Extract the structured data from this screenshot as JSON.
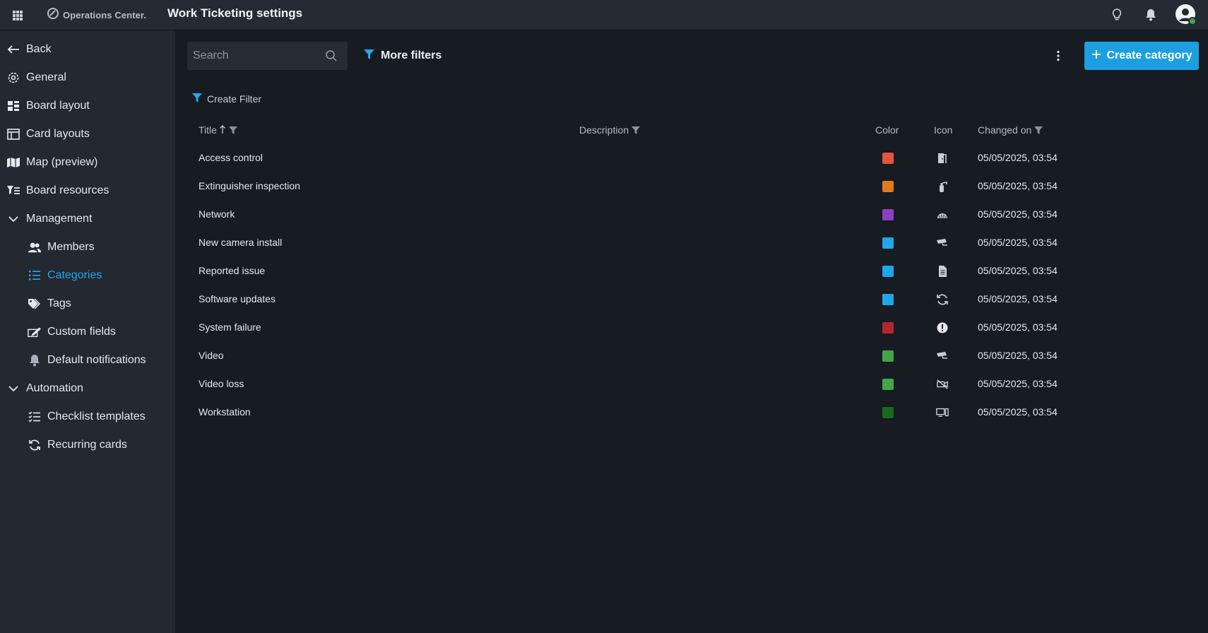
{
  "app": {
    "brand": "Operations Center.",
    "page_title": "Work Ticketing settings"
  },
  "sidebar": {
    "back": "Back",
    "general": "General",
    "board_layout": "Board layout",
    "card_layouts": "Card layouts",
    "map_preview": "Map (preview)",
    "board_resources": "Board resources",
    "management": "Management",
    "members": "Members",
    "categories": "Categories",
    "tags": "Tags",
    "custom_fields": "Custom fields",
    "default_notifications": "Default notifications",
    "automation": "Automation",
    "checklist_templates": "Checklist templates",
    "recurring_cards": "Recurring cards",
    "active_item": "Categories"
  },
  "toolbar": {
    "search_placeholder": "Search",
    "more_filters": "More filters",
    "create_category": "Create category",
    "create_filter": "Create Filter"
  },
  "table": {
    "headers": {
      "title": "Title",
      "description": "Description",
      "color": "Color",
      "icon": "Icon",
      "changed_on": "Changed on"
    },
    "sort": {
      "column": "Title",
      "direction": "ascending"
    },
    "rows": [
      {
        "title": "Access control",
        "description": "",
        "color": "#e5533c",
        "icon": "door-icon",
        "changed_on": "05/05/2025, 03:54"
      },
      {
        "title": "Extinguisher inspection",
        "description": "",
        "color": "#e07b1c",
        "icon": "fire-extinguisher-icon",
        "changed_on": "05/05/2025, 03:54"
      },
      {
        "title": "Network",
        "description": "",
        "color": "#8b3fc6",
        "icon": "network-icon",
        "changed_on": "05/05/2025, 03:54"
      },
      {
        "title": "New camera install",
        "description": "",
        "color": "#1ea7ea",
        "icon": "camera-icon",
        "changed_on": "05/05/2025, 03:54"
      },
      {
        "title": "Reported issue",
        "description": "",
        "color": "#1ea7ea",
        "icon": "document-icon",
        "changed_on": "05/05/2025, 03:54"
      },
      {
        "title": "Software updates",
        "description": "",
        "color": "#1ea7ea",
        "icon": "refresh-icon",
        "changed_on": "05/05/2025, 03:54"
      },
      {
        "title": "System failure",
        "description": "",
        "color": "#b5262e",
        "icon": "alert-icon",
        "changed_on": "05/05/2025, 03:54"
      },
      {
        "title": "Video",
        "description": "",
        "color": "#43a74a",
        "icon": "camera-icon",
        "changed_on": "05/05/2025, 03:54"
      },
      {
        "title": "Video loss",
        "description": "",
        "color": "#43a74a",
        "icon": "video-off-icon",
        "changed_on": "05/05/2025, 03:54"
      },
      {
        "title": "Workstation",
        "description": "",
        "color": "#176b1e",
        "icon": "workstation-icon",
        "changed_on": "05/05/2025, 03:54"
      }
    ]
  },
  "colors": {
    "accent": "#1c9fe0",
    "active_nav": "#25a8ea",
    "background": "#171b22",
    "sidebar": "#232831",
    "topbar": "#252a33"
  }
}
